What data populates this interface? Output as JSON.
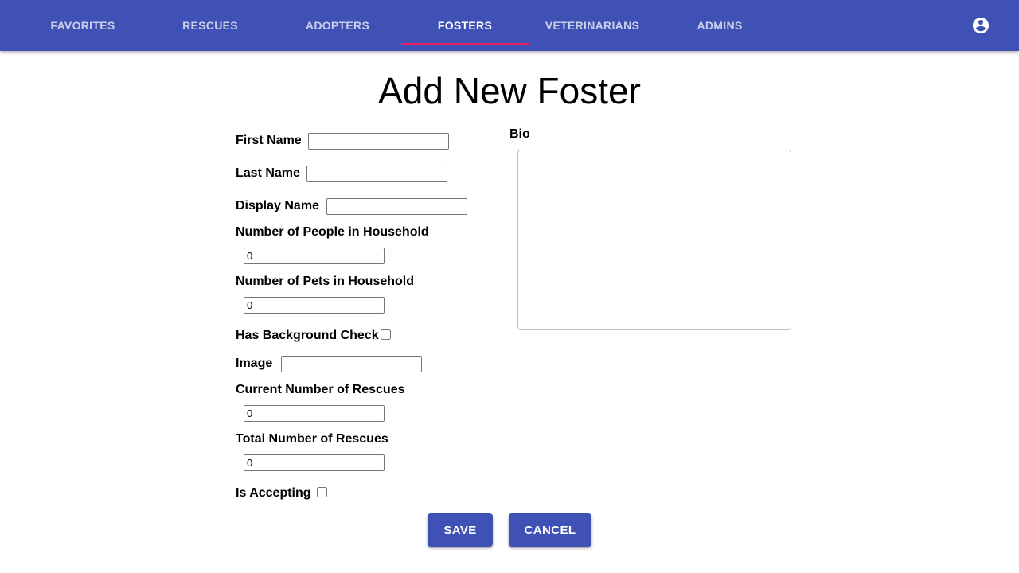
{
  "nav": {
    "tabs": [
      {
        "label": "FAVORITES"
      },
      {
        "label": "RESCUES"
      },
      {
        "label": "ADOPTERS"
      },
      {
        "label": "FOSTERS",
        "active": true
      },
      {
        "label": "VETERINARIANS"
      },
      {
        "label": "ADMINS"
      }
    ],
    "account_icon": "account-circle-icon",
    "indicator_color": "#e91e63",
    "bar_color": "#3f51b5"
  },
  "page": {
    "title": "Add New Foster"
  },
  "form": {
    "first_name": {
      "label": "First Name",
      "value": ""
    },
    "last_name": {
      "label": "Last Name",
      "value": ""
    },
    "display_name": {
      "label": "Display Name",
      "value": ""
    },
    "people_in_household": {
      "label": "Number of People in Household",
      "value": "0"
    },
    "pets_in_household": {
      "label": "Number of Pets in Household",
      "value": "0"
    },
    "background_check": {
      "label": "Has Background Check",
      "checked": false
    },
    "image": {
      "label": "Image",
      "value": ""
    },
    "current_rescues": {
      "label": "Current Number of Rescues",
      "value": "0"
    },
    "total_rescues": {
      "label": "Total Number of Rescues",
      "value": "0"
    },
    "is_accepting": {
      "label": "Is Accepting",
      "checked": false
    },
    "bio": {
      "label": "Bio",
      "value": ""
    }
  },
  "actions": {
    "save_label": "SAVE",
    "cancel_label": "CANCEL"
  }
}
